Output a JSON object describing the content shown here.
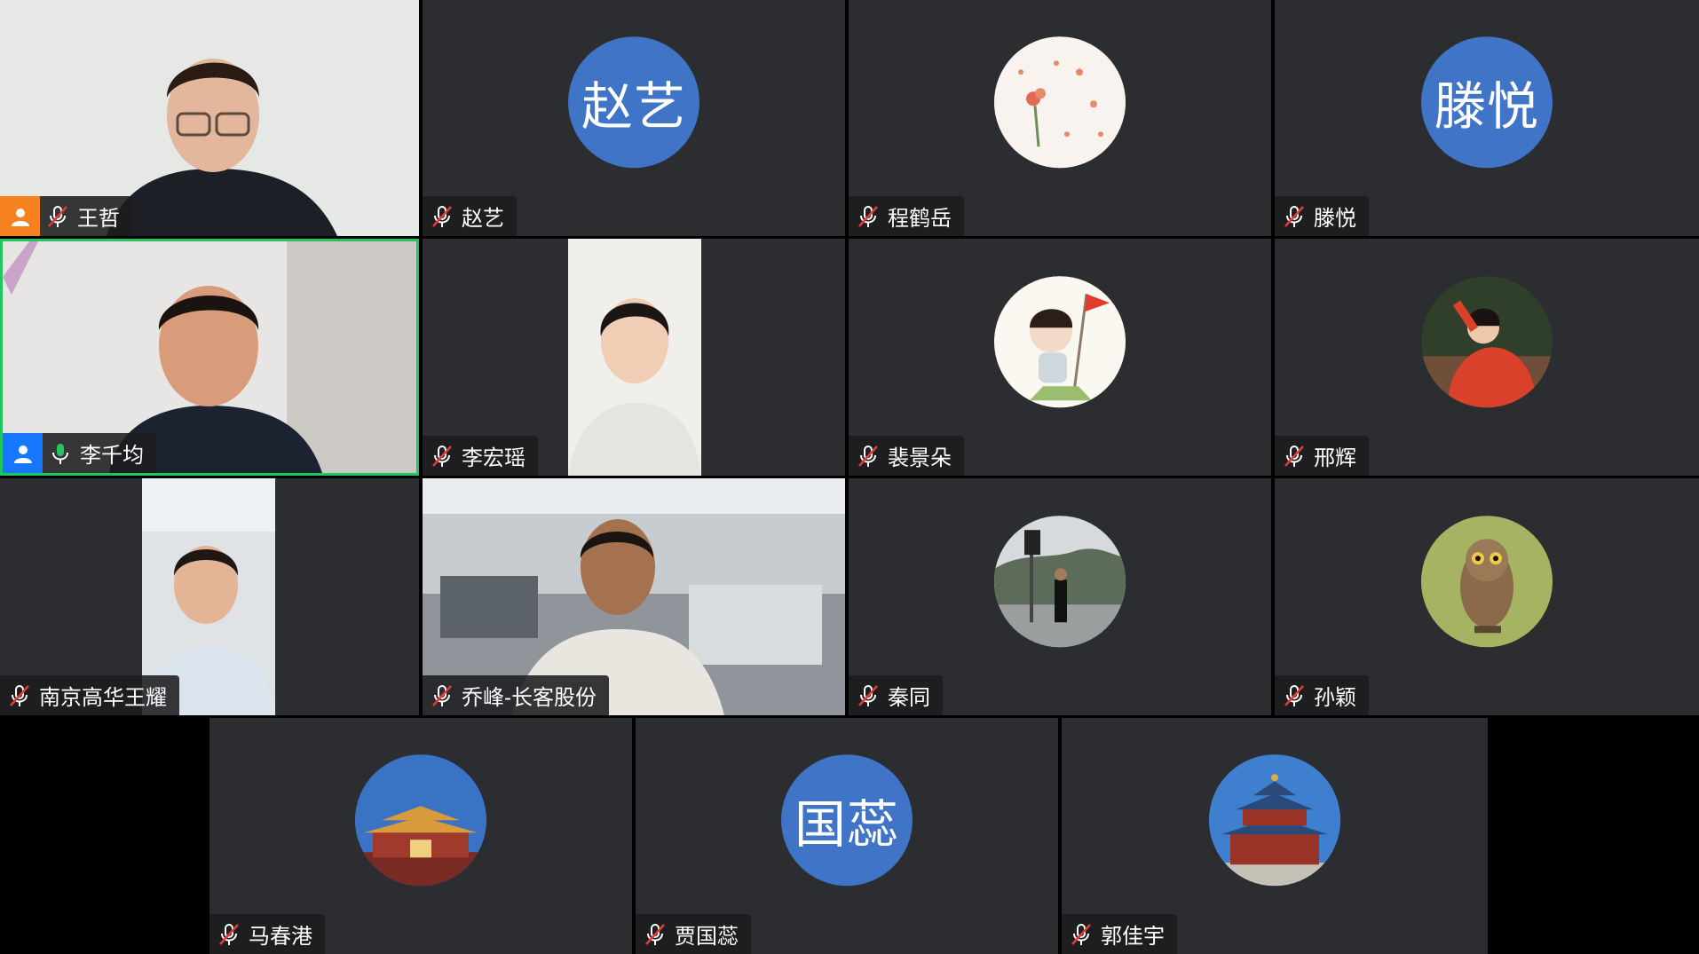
{
  "participants": [
    {
      "name": "王哲"
    },
    {
      "name": "赵艺",
      "avatar_text": "赵艺"
    },
    {
      "name": "程鹤岳"
    },
    {
      "name": "滕悦",
      "avatar_text": "滕悦"
    },
    {
      "name": "李千均"
    },
    {
      "name": "李宏瑶"
    },
    {
      "name": "裴景朵"
    },
    {
      "name": "邢辉"
    },
    {
      "name": "南京高华王耀"
    },
    {
      "name": "乔峰-长客股份"
    },
    {
      "name": "秦同"
    },
    {
      "name": "孙颖"
    },
    {
      "name": "马春港"
    },
    {
      "name": "贾国蕊",
      "avatar_text": "国蕊"
    },
    {
      "name": "郭佳宇"
    }
  ],
  "colors": {
    "tile_bg": "#2b2d30",
    "active_speaker_border": "#22c55e",
    "avatar_blue": "#3f74c6",
    "host_badge": "#f5821f",
    "cohost_badge": "#1677ff",
    "mic_on": "#22c55e",
    "mic_muted": "#ffffff"
  }
}
